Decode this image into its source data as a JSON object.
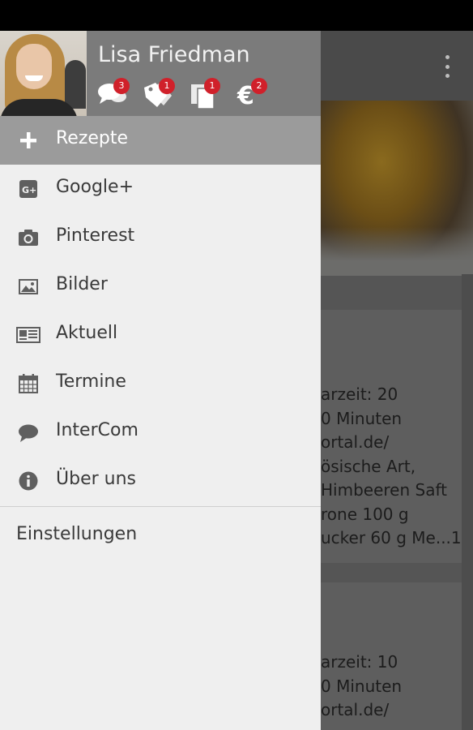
{
  "profile": {
    "name": "Lisa Friedman",
    "notifications": [
      {
        "icon": "chat-bubbles-icon",
        "count": "3"
      },
      {
        "icon": "tags-icon",
        "count": "1"
      },
      {
        "icon": "documents-icon",
        "count": "1"
      },
      {
        "icon": "euro-icon",
        "count": "2"
      }
    ]
  },
  "menu": {
    "active_label": "Rezepte",
    "items": [
      {
        "label": "Google+",
        "icon": "google-plus-icon"
      },
      {
        "label": "Pinterest",
        "icon": "camera-icon"
      },
      {
        "label": "Bilder",
        "icon": "image-icon"
      },
      {
        "label": "Aktuell",
        "icon": "newspaper-icon"
      },
      {
        "label": "Termine",
        "icon": "calendar-icon"
      },
      {
        "label": "InterCom",
        "icon": "speech-bubble-icon"
      },
      {
        "label": "Über uns",
        "icon": "info-icon"
      }
    ],
    "settings_label": "Einstellungen"
  },
  "background": {
    "card1_lines": [
      "arzeit: 20",
      "0 Minuten",
      "ortal.de/",
      "ösische Art,",
      "Himbeeren Saft",
      "rone 100 g",
      "ucker 60 g Me...1"
    ],
    "card2_lines": [
      "arzeit: 10",
      "0 Minuten",
      "ortal.de/"
    ]
  },
  "colors": {
    "badge": "#d0202a",
    "profile_bg": "#7b7b7b",
    "active_item_bg": "#9b9b9b",
    "drawer_bg": "#efefef"
  }
}
